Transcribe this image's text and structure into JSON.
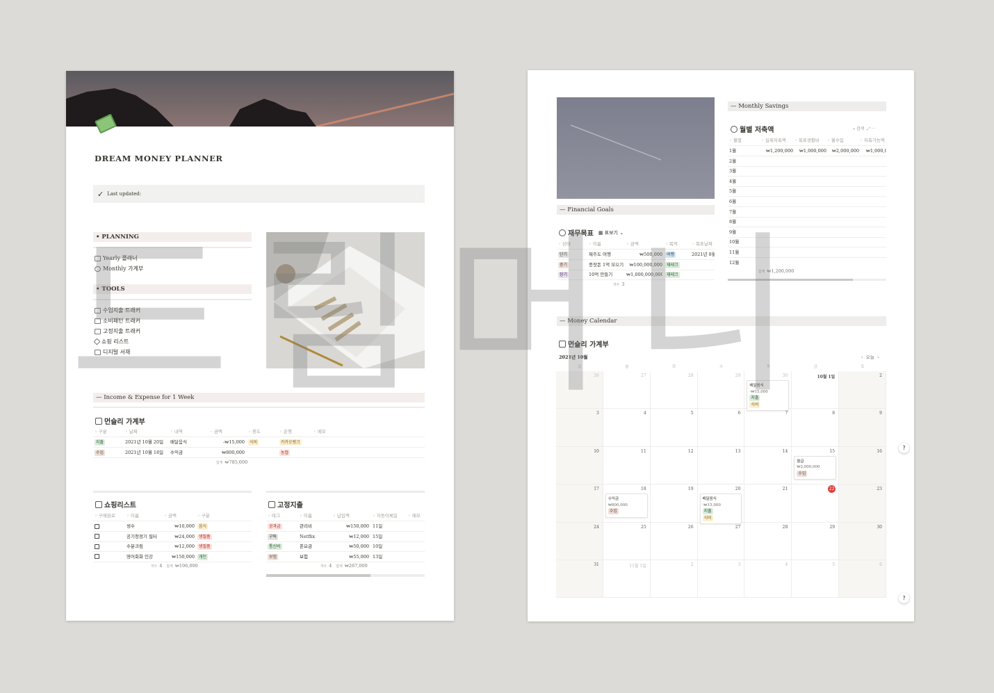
{
  "left": {
    "title": "DREAM MONEY PLANNER",
    "callout": "Last updated:",
    "planning": {
      "label": "PLANNING",
      "items": [
        "Yearly 플래너",
        "Monthly 가계부"
      ]
    },
    "tools": {
      "label": "TOOLS",
      "items": [
        "수입지출 트래커",
        "소비패턴 트래커",
        "고정지출 트래커",
        "쇼핑 리스트",
        "디지털 서재"
      ]
    },
    "income_heading": "Income & Expense for 1 Week",
    "monthly_ledger": {
      "title": "먼슬리 가계부",
      "columns": [
        "구분",
        "날짜",
        "내역",
        "금액",
        "용도",
        "은행",
        "메모"
      ],
      "rows": [
        [
          {
            "tag": "지출",
            "color": "green"
          },
          "2021년 10월 20일",
          "배달음식",
          "-₩15,000",
          {
            "tag": "식비",
            "color": "yellow"
          },
          {
            "tag": "카카오뱅크",
            "color": "yellow"
          },
          ""
        ],
        [
          {
            "tag": "수입",
            "color": "brown"
          },
          "2021년 10월 18일",
          "수익금",
          "₩800,000",
          "",
          {
            "tag": "농협",
            "color": "red"
          },
          ""
        ]
      ],
      "sum_label": "합계",
      "sum": "₩785,000"
    },
    "shopping": {
      "title": "쇼핑리스트",
      "columns": [
        "구매완료",
        "이름",
        "금액",
        "구분"
      ],
      "rows": [
        [
          {
            "check": false
          },
          "생수",
          "₩10,000",
          {
            "tag": "음식",
            "color": "yellow"
          }
        ],
        [
          {
            "check": false
          },
          "공기청정기 필터",
          "₩24,000",
          {
            "tag": "생필품",
            "color": "red"
          }
        ],
        [
          {
            "check": false
          },
          "수분크림",
          "₩12,000",
          {
            "tag": "생필품",
            "color": "red"
          }
        ],
        [
          {
            "check": false
          },
          "영어회화 인강",
          "₩150,000",
          {
            "tag": "개인",
            "color": "green"
          }
        ]
      ],
      "count_label": "개수",
      "count": "4",
      "sum_label": "합계",
      "sum": "₩196,000"
    },
    "fixed": {
      "title": "고정지출",
      "columns": [
        "태그",
        "이름",
        "납입액",
        "자동이체일",
        "메모"
      ],
      "rows": [
        [
          {
            "tag": "공과금",
            "color": "red"
          },
          "관리비",
          "₩150,000",
          "11일",
          ""
        ],
        [
          {
            "tag": "구독",
            "color": "gray"
          },
          "Netflix",
          "₩12,000",
          "15일",
          ""
        ],
        [
          {
            "tag": "통신비",
            "color": "green"
          },
          "폰요금",
          "₩50,000",
          "10일",
          ""
        ],
        [
          {
            "tag": "보험",
            "color": "brown"
          },
          "보험",
          "₩55,000",
          "13일",
          ""
        ]
      ],
      "count_label": "개수",
      "count": "4",
      "sum_label": "합계",
      "sum": "₩267,000"
    }
  },
  "right": {
    "financial_goals_heading": "Financial Goals",
    "goals": {
      "title": "재무목표",
      "view": "표보기",
      "columns": [
        "상태",
        "이름",
        "금액",
        "목적",
        "목표날짜"
      ],
      "rows": [
        [
          {
            "tag": "단기",
            "color": "gray"
          },
          "제주도 여행",
          "₩500,000",
          {
            "tag": "여행",
            "color": "blue"
          },
          "2021년 8월"
        ],
        [
          {
            "tag": "중기",
            "color": "brown"
          },
          "종잣돈 1억 모으기",
          "₩100,000,000",
          {
            "tag": "재테크",
            "color": "green"
          },
          ""
        ],
        [
          {
            "tag": "장기",
            "color": "purple"
          },
          "10억 만들기",
          "₩1,000,000,000",
          {
            "tag": "재테크",
            "color": "green"
          },
          ""
        ]
      ],
      "count_label": "개수",
      "count": "3"
    },
    "monthly_savings_heading": "Monthly Savings",
    "savings": {
      "title": "월별 저축액",
      "search": "검색",
      "columns": [
        "월별",
        "실제저축액",
        "목표생활비",
        "월수입",
        "저축가능액"
      ],
      "rows": [
        [
          "1월",
          "₩1,200,000",
          "₩1,000,000",
          "₩2,000,000",
          "₩1,000,000"
        ],
        [
          "2월",
          "",
          "",
          "",
          ""
        ],
        [
          "3월",
          "",
          "",
          "",
          ""
        ],
        [
          "4월",
          "",
          "",
          "",
          ""
        ],
        [
          "5월",
          "",
          "",
          "",
          ""
        ],
        [
          "6월",
          "",
          "",
          "",
          ""
        ],
        [
          "7월",
          "",
          "",
          "",
          ""
        ],
        [
          "8월",
          "",
          "",
          "",
          ""
        ],
        [
          "9월",
          "",
          "",
          "",
          ""
        ],
        [
          "10월",
          "",
          "",
          "",
          ""
        ],
        [
          "11월",
          "",
          "",
          "",
          ""
        ],
        [
          "12월",
          "",
          "",
          "",
          ""
        ]
      ],
      "sum_label": "합계",
      "sum": "₩1,200,000"
    },
    "money_calendar_heading": "Money Calendar",
    "calendar": {
      "title": "먼슬리 가계부",
      "month": "2021년 10월",
      "today_label": "오늘",
      "weekdays": [
        "일",
        "월",
        "화",
        "수",
        "목",
        "금",
        "토"
      ],
      "weeks": [
        [
          {
            "d": "26",
            "dim": true
          },
          {
            "d": "27",
            "dim": true
          },
          {
            "d": "28",
            "dim": true
          },
          {
            "d": "29",
            "dim": true
          },
          {
            "d": "30",
            "dim": true
          },
          {
            "d": "10월 1일"
          },
          {
            "d": "2"
          }
        ],
        [
          {
            "d": "3"
          },
          {
            "d": "4"
          },
          {
            "d": "5"
          },
          {
            "d": "6"
          },
          {
            "d": "7"
          },
          {
            "d": "8"
          },
          {
            "d": "9"
          }
        ],
        [
          {
            "d": "10"
          },
          {
            "d": "11"
          },
          {
            "d": "12"
          },
          {
            "d": "13"
          },
          {
            "d": "14"
          },
          {
            "d": "15"
          },
          {
            "d": "16"
          }
        ],
        [
          {
            "d": "17"
          },
          {
            "d": "18"
          },
          {
            "d": "19"
          },
          {
            "d": "20"
          },
          {
            "d": "21"
          },
          {
            "d": "22",
            "today": true
          },
          {
            "d": "23"
          }
        ],
        [
          {
            "d": "24"
          },
          {
            "d": "25"
          },
          {
            "d": "26"
          },
          {
            "d": "27"
          },
          {
            "d": "28"
          },
          {
            "d": "29"
          },
          {
            "d": "30"
          }
        ],
        [
          {
            "d": "31"
          },
          {
            "d": "11월 1일",
            "dim": true
          },
          {
            "d": "2",
            "dim": true
          },
          {
            "d": "3",
            "dim": true
          },
          {
            "d": "4",
            "dim": true
          },
          {
            "d": "5",
            "dim": true
          },
          {
            "d": "6",
            "dim": true
          }
        ]
      ],
      "events": [
        {
          "week": 0,
          "day": 4,
          "name": "배달음식",
          "amount": "-₩15,000",
          "tags": [
            {
              "tag": "지출",
              "color": "green"
            },
            {
              "tag": "식비",
              "color": "yellow"
            }
          ]
        },
        {
          "week": 2,
          "day": 5,
          "name": "월급",
          "amount": "₩2,000,000",
          "tags": [
            {
              "tag": "수입",
              "color": "brown"
            }
          ]
        },
        {
          "week": 3,
          "day": 1,
          "name": "수익금",
          "amount": "₩800,000",
          "tags": [
            {
              "tag": "수입",
              "color": "brown"
            }
          ]
        },
        {
          "week": 3,
          "day": 3,
          "name": "배달음식",
          "amount": "-₩15,000",
          "tags": [
            {
              "tag": "지출",
              "color": "green"
            },
            {
              "tag": "식비",
              "color": "yellow"
            }
          ]
        }
      ]
    },
    "help": "?"
  },
  "watermark": "드림머니",
  "tag_colors": {
    "green": [
      "#dbeddb",
      "#2b593f"
    ],
    "yellow": [
      "#fbf0cf",
      "#89632a"
    ],
    "brown": [
      "#eee0da",
      "#64473a"
    ],
    "red": [
      "#ffe2dd",
      "#9f2b20"
    ],
    "gray": [
      "#e3e2e0",
      "#32302c"
    ],
    "blue": [
      "#d3e5ef",
      "#28456c"
    ],
    "purple": [
      "#e8deee",
      "#492f64"
    ]
  }
}
